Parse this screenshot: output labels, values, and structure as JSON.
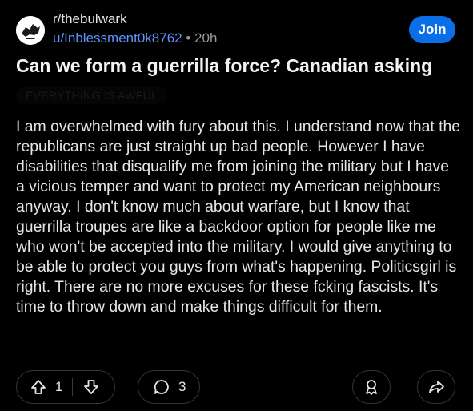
{
  "post": {
    "subreddit": "r/thebulwark",
    "username": "u/Inblessment0k8762",
    "separator": "•",
    "age": "20h",
    "join_label": "Join",
    "title": "Can we form a guerrilla force? Canadian asking",
    "flair": "EVERYTHING IS AWFUL",
    "body": "I am overwhelmed with fury about this. I understand now that the republicans are just straight up bad people. However I have disabilities that disqualify me from joining the military but I have a vicious temper and want to protect my American neighbours anyway. I don't know much about warfare, but I know that guerrilla troupes are like a backdoor option for people like me who won't be accepted into the military. I would give anything to be able to protect you guys from what's happening. Politicsgirl is right. There are no more excuses for these fcking fascists. It's time to throw down and make things difficult for them."
  },
  "actions": {
    "upvote_count": "1",
    "comment_count": "3",
    "icons": [
      "upvote-icon",
      "downvote-icon",
      "comment-icon",
      "award-icon",
      "share-icon"
    ]
  },
  "colors": {
    "background": "#000000",
    "text": "#e6e6e6",
    "username": "#5f93ff",
    "join_button": "#0a6ee6",
    "muted": "#9a9a9a"
  }
}
